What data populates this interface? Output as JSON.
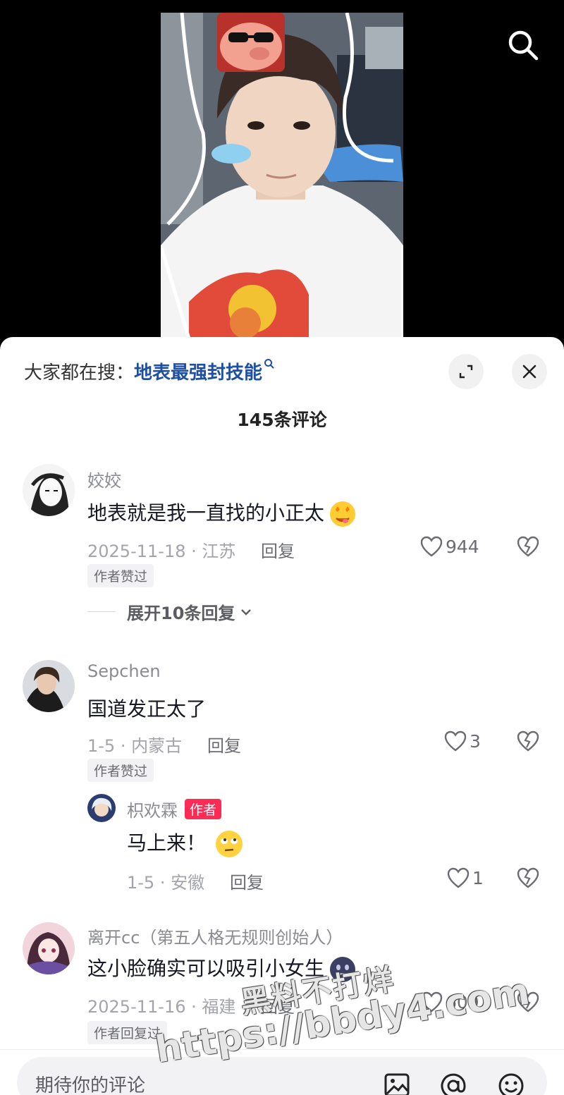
{
  "top_bar": {
    "search_icon": "search-icon"
  },
  "hot_search": {
    "prefix": "大家都在搜：",
    "keyword": "地表最强封技能"
  },
  "sheet": {
    "expand_icon": "expand-icon",
    "close_icon": "close-icon",
    "comment_count": "145条评论"
  },
  "comments": [
    {
      "username": "姣姣",
      "text": "地表就是我一直找的小正太",
      "emoji": "star-eyes-emoji",
      "meta": "2025-11-18 · 江苏",
      "reply_label": "回复",
      "likes": "944",
      "tag": "作者赞过",
      "expand_label": "展开10条回复"
    },
    {
      "username": "Sepchen",
      "text": "国道发正太了",
      "meta": "1-5 · 内蒙古",
      "reply_label": "回复",
      "likes": "3",
      "tag": "作者赞过",
      "replies": [
        {
          "username": "枳欢霖",
          "badge": "作者",
          "text": "马上来！",
          "emoji": "eye-roll-emoji",
          "meta": "1-5 · 安徽",
          "reply_label": "回复",
          "likes": "1"
        }
      ]
    },
    {
      "username": "离开cc（第五人格无规则创始人）",
      "text": "这小脸确实可以吸引小女生",
      "emoji": "dark-face-emoji",
      "meta": "2025-11-16 · 福建",
      "reply_label": "回复",
      "likes": "609",
      "tag": "作者回复过"
    }
  ],
  "input_bar": {
    "placeholder": "期待你的评论",
    "icons": [
      "image-icon",
      "at-icon",
      "emoji-icon"
    ]
  },
  "watermark": {
    "line1": "黑料不打烊",
    "line2": "https://bbdy4.com"
  },
  "colors": {
    "author_badge": "#fe2c55",
    "keyword": "#1f4fa0",
    "sheet_bg": "#ffffff"
  }
}
